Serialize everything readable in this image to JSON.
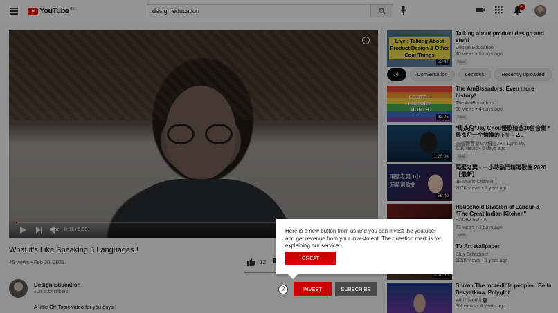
{
  "header": {
    "logo_text": "YouTube",
    "logo_region": "GB",
    "search_value": "design education",
    "notification_count": "9+"
  },
  "video": {
    "title": "What it's Like Speaking 5 Languages !",
    "views": "45 views",
    "date": "Feb 20, 2021",
    "meta": "45 views • Feb 20, 2021",
    "likes": "12",
    "time": "0:01 / 5:59",
    "progress_fraction": 0.003
  },
  "channel": {
    "name": "Design Education",
    "subscribers": "208 subscribers",
    "description": "A little Off-Topic video for you guys !"
  },
  "actions": {
    "help_glyph": "?",
    "invest_label": "INVEST",
    "subscribe_label": "SUBSCRIBE"
  },
  "tooltip": {
    "text": "Here is a new button from us and you can invest the youtuber and get revenue from your investment. The question mark is for explaining our service.",
    "button_label": "GREAT"
  },
  "chips": [
    "All",
    "Conversation",
    "Lessons",
    "Recently uploaded"
  ],
  "recommendations": [
    {
      "title": "Talking about product design and stuff!",
      "channel": "Design Education",
      "stats": "40 views • 5 days ago",
      "badge": "New",
      "duration": "55:47",
      "thumb_text": "Live : Talking About Product Design & Other Cool Things"
    },
    {
      "title": "The AmBIssadors: Even more history!",
      "channel": "The AmBIssadors",
      "stats": "58 views • 4 days ago",
      "badge": "New",
      "duration": "32:05",
      "thumb_text": "LGBTQ+ HISTORY MONTH"
    },
    {
      "title": "*周杰伦*Jay Chou慢歌精选20首合集 *周杰伦一个慵懒的下午 - 2...",
      "channel": "杰威爾音樂MV頻道JVR Lyric MV",
      "stats": "12K views • 6 days ago",
      "badge": "New",
      "duration": "1:25:04",
      "thumb_text": ""
    },
    {
      "title": "隔壁老樊 - 一小時熱門精選歌曲 2020【最新】",
      "channel": "JE Music Channel",
      "stats": "207K views • 1 year ago",
      "badge": "",
      "duration": "56:40",
      "thumb_text": "隔壁老樊 1小時精選歌曲"
    },
    {
      "title": "Household Division of Labour & \"The Great Indian Kitchen\"",
      "channel": "RADIO SOFIA",
      "stats": "73 views • 3 days ago",
      "badge": "New",
      "duration": "",
      "thumb_text": ""
    },
    {
      "title": "TV Art Wallpaper",
      "channel": "Clay Schubiner",
      "stats": "109K views • 1 year ago",
      "badge": "",
      "duration": "1:56:40",
      "thumb_text": ""
    },
    {
      "title": "Show «The Incredible people». Bella Devyatkina. Polyglot",
      "channel": "WeiT Media",
      "stats": "3M views • 4 years ago",
      "badge": "",
      "duration": "",
      "thumb_text": ""
    }
  ],
  "colors": {
    "accent": "#cc0000",
    "overlay": "rgba(0,0,0,0.42)"
  }
}
